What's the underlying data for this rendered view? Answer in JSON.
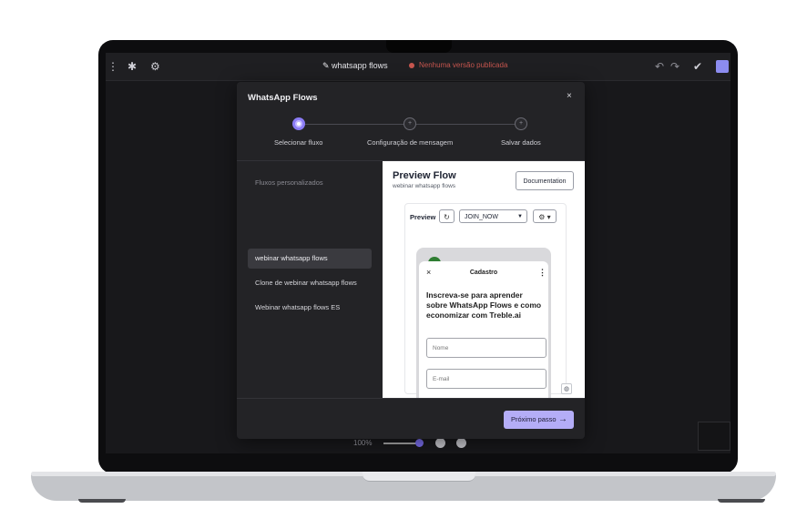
{
  "topbar": {
    "left_icons": [
      "ellipsis-icon",
      "puzzle-icon",
      "gear-icon"
    ],
    "flow_name": "whatsapp flows",
    "version_status": "Nenhuma versão publicada",
    "right_icons": [
      "undo-icon",
      "redo-icon",
      "check-circle-icon"
    ]
  },
  "modal": {
    "title": "WhatsApp Flows",
    "close_glyph": "×",
    "steps": [
      {
        "label": "Selecionar fluxo",
        "state": "active"
      },
      {
        "label": "Configuração de mensagem",
        "state": "inactive"
      },
      {
        "label": "Salvar dados",
        "state": "inactive"
      }
    ],
    "list_heading": "Fluxos personalizados",
    "flows": [
      {
        "label": "webinar whatsapp flows",
        "selected": true
      },
      {
        "label": "Clone de webinar whatsapp flows",
        "selected": false
      },
      {
        "label": "Webinar whatsapp flows ES",
        "selected": false
      }
    ],
    "next_button": "Próximo passo",
    "next_arrow": "→"
  },
  "preview": {
    "title": "Preview Flow",
    "subtitle": "webinar whatsapp flows",
    "documentation_button": "Documentation",
    "preview_label": "Preview",
    "refresh_glyph": "↻",
    "screen_select": "JOIN_NOW",
    "select_caret": "▼",
    "settings_glyph": "⚙ ▾",
    "sheet": {
      "close": "×",
      "title": "Cadastro",
      "menu": "⋮",
      "heading": "Inscreva-se para aprender sobre WhatsApp Flows e como economizar com Treble.ai",
      "fields": [
        "Nome",
        "E-mail"
      ]
    }
  },
  "zoom": {
    "level": "100%"
  },
  "colors": {
    "accent": "#b4adf7",
    "step_active": "#8b7cf5",
    "status_red": "#c7564f",
    "modal_bg": "#232326"
  }
}
